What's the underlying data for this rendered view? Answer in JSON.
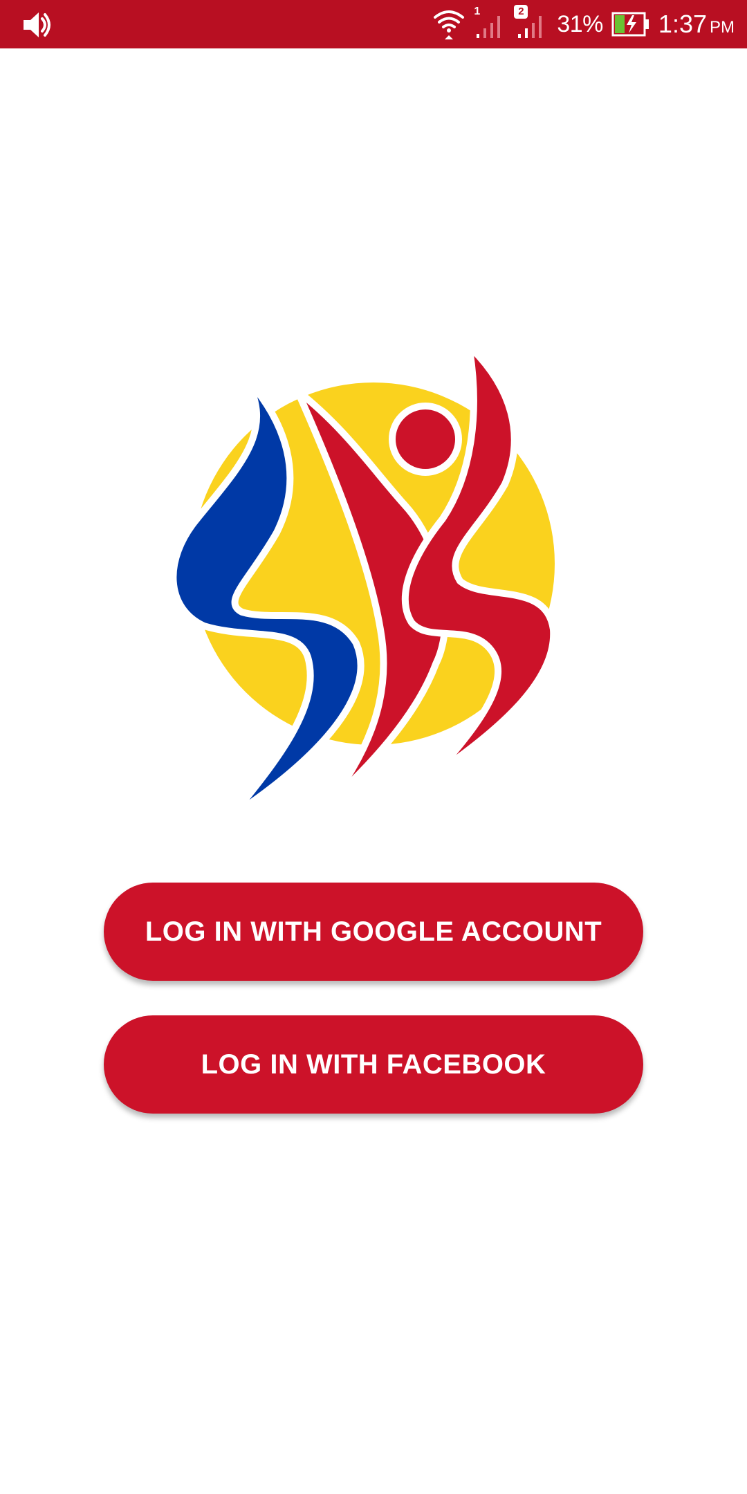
{
  "status_bar": {
    "battery_percent": "31%",
    "time": "1:37",
    "ampm": "PM",
    "sim1_label": "1",
    "sim2_label": "2",
    "battery_level": 0.31,
    "icons": [
      "volume-icon",
      "wifi-icon",
      "signal-sim1-icon",
      "signal-sim2-icon",
      "battery-charging-icon"
    ]
  },
  "logo": {
    "colors": {
      "blue": "#0039a6",
      "red": "#cc1229",
      "yellow": "#fad21e"
    }
  },
  "buttons": {
    "google_label": "LOG IN WITH GOOGLE ACCOUNT",
    "facebook_label": "LOG IN WITH FACEBOOK"
  },
  "theme": {
    "status_bar_color": "#b80f22",
    "button_color": "#cc1229",
    "button_text_color": "#ffffff",
    "background": "#ffffff"
  }
}
